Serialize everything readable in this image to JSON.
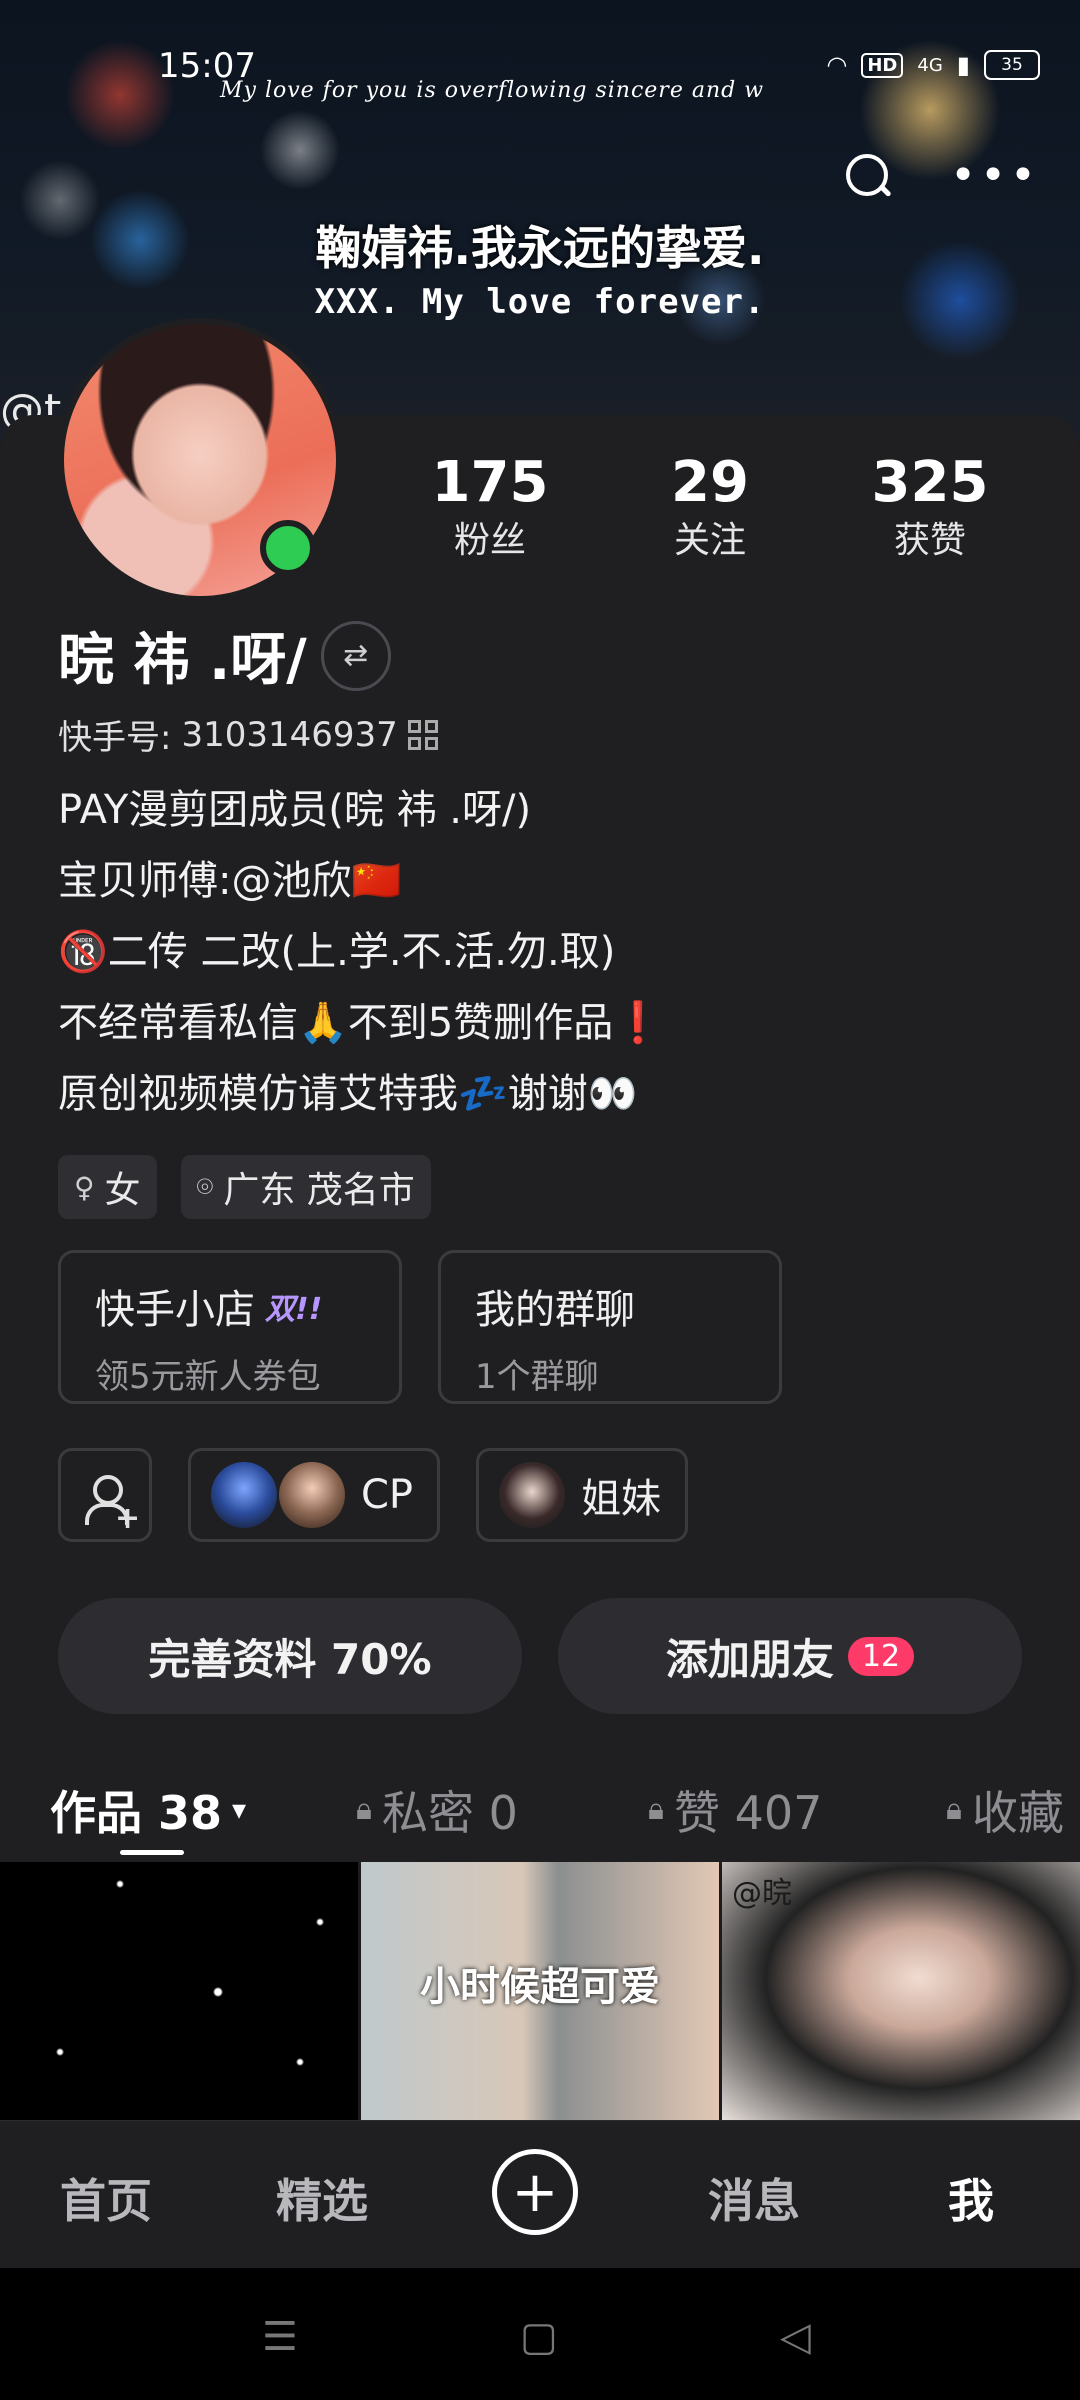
{
  "status_bar": {
    "time": "15:07",
    "network": "4G",
    "hd": "HD",
    "battery": "35"
  },
  "banner": {
    "script_text": "My love for you is overflowing sincere and w",
    "line1": "鞠婧祎.我永远的挚爱.",
    "line2": "XXX. My love forever.",
    "at_fragment": "@t"
  },
  "profile": {
    "name": "晥 祎 .呀/",
    "kuaishou_id_label": "快手号:",
    "kuaishou_id": "3103146937",
    "bio": [
      "PAY漫剪团成员(晥 祎 .呀/)",
      "宝贝师傅:@池欣🇨🇳",
      "🔞二传 二改(上.学.不.活.勿.取)",
      "不经常看私信🙏不到5赞删作品❗",
      "原创视频模仿请艾特我💤谢谢👀"
    ],
    "gender_tag": "女",
    "location_tag": "广东 茂名市"
  },
  "stats": [
    {
      "value": "175",
      "label": "粉丝"
    },
    {
      "value": "29",
      "label": "关注"
    },
    {
      "value": "325",
      "label": "获赞"
    }
  ],
  "shop": {
    "title": "快手小店",
    "badge": "双!!",
    "subtitle": "领5元新人券包"
  },
  "group_chat": {
    "title": "我的群聊",
    "subtitle": "1个群聊"
  },
  "relations": [
    {
      "label": "CP"
    },
    {
      "label": "姐妹"
    }
  ],
  "actions": {
    "complete_profile": "完善资料 70%",
    "add_friends": "添加朋友",
    "add_friends_badge": "12"
  },
  "tabs": {
    "works": "作品 38",
    "private": "私密 0",
    "likes": "赞 407",
    "collect": "收藏"
  },
  "thumbnails": {
    "t2_caption": "小时候超可爱",
    "t3_overlay": "@晥"
  },
  "bottom_nav": {
    "home": "首页",
    "featured": "精选",
    "plus": "+",
    "messages": "消息",
    "me": "我"
  },
  "colors": {
    "background": "#1f1f22",
    "accent_badge": "#fe3b68",
    "online": "#2ecc52"
  }
}
